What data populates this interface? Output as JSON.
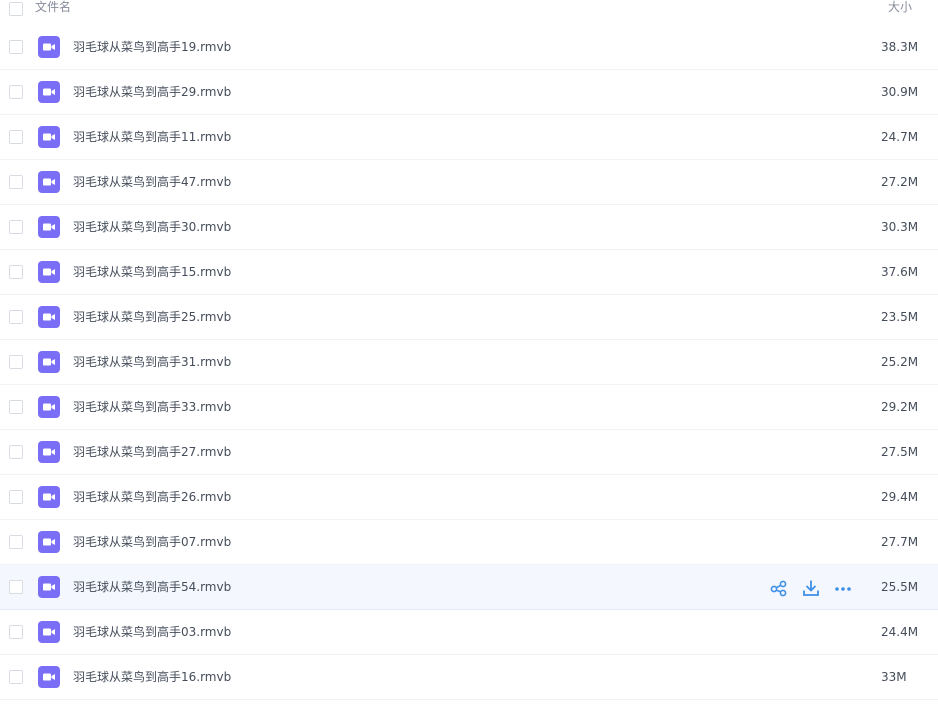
{
  "header": {
    "name_label": "文件名",
    "size_label": "大小"
  },
  "files": [
    {
      "name": "羽毛球从菜鸟到高手19.rmvb",
      "size": "38.3M",
      "icon": "video-file-icon"
    },
    {
      "name": "羽毛球从菜鸟到高手29.rmvb",
      "size": "30.9M",
      "icon": "video-file-icon"
    },
    {
      "name": "羽毛球从菜鸟到高手11.rmvb",
      "size": "24.7M",
      "icon": "video-file-icon"
    },
    {
      "name": "羽毛球从菜鸟到高手47.rmvb",
      "size": "27.2M",
      "icon": "video-file-icon"
    },
    {
      "name": "羽毛球从菜鸟到高手30.rmvb",
      "size": "30.3M",
      "icon": "video-file-icon"
    },
    {
      "name": "羽毛球从菜鸟到高手15.rmvb",
      "size": "37.6M",
      "icon": "video-file-icon"
    },
    {
      "name": "羽毛球从菜鸟到高手25.rmvb",
      "size": "23.5M",
      "icon": "video-file-icon"
    },
    {
      "name": "羽毛球从菜鸟到高手31.rmvb",
      "size": "25.2M",
      "icon": "video-file-icon"
    },
    {
      "name": "羽毛球从菜鸟到高手33.rmvb",
      "size": "29.2M",
      "icon": "video-file-icon"
    },
    {
      "name": "羽毛球从菜鸟到高手27.rmvb",
      "size": "27.5M",
      "icon": "video-file-icon"
    },
    {
      "name": "羽毛球从菜鸟到高手26.rmvb",
      "size": "29.4M",
      "icon": "video-file-icon"
    },
    {
      "name": "羽毛球从菜鸟到高手07.rmvb",
      "size": "27.7M",
      "icon": "video-file-icon"
    },
    {
      "name": "羽毛球从菜鸟到高手54.rmvb",
      "size": "25.5M",
      "icon": "video-file-icon",
      "hovered": true
    },
    {
      "name": "羽毛球从菜鸟到高手03.rmvb",
      "size": "24.4M",
      "icon": "video-file-icon"
    },
    {
      "name": "羽毛球从菜鸟到高手16.rmvb",
      "size": "33M",
      "icon": "video-file-icon"
    }
  ],
  "row_actions": [
    "share-icon",
    "download-icon",
    "more-icon"
  ],
  "colors": {
    "file_icon": "#7b6ef6",
    "action_icon": "#3e8fe5",
    "hover_row": "#f4f8fe"
  }
}
